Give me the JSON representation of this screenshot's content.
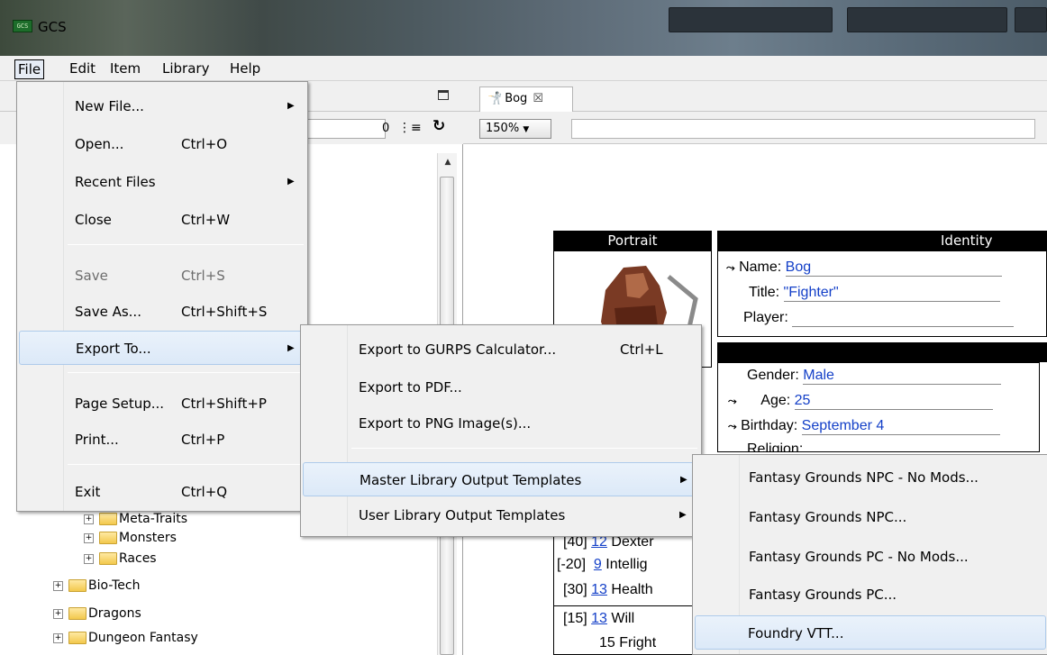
{
  "window": {
    "title": "GCS",
    "app_icon": "gcs-app-icon"
  },
  "menubar": [
    "File",
    "Edit",
    "Item",
    "Library",
    "Help"
  ],
  "library": {
    "search_count": "0",
    "tree": [
      {
        "label": "Meta-Traits"
      },
      {
        "label": "Monsters"
      },
      {
        "label": "Races"
      },
      {
        "label": "Bio-Tech"
      },
      {
        "label": "Dragons"
      },
      {
        "label": "Dungeon Fantasy"
      }
    ]
  },
  "sheet": {
    "tab_label": "Bog",
    "zoom": "150%",
    "portrait_header": "Portrait",
    "identity_header": "Identity",
    "identity": {
      "name_label": "Name:",
      "name": "Bog",
      "title_label": "Title:",
      "title": "\"Fighter\"",
      "player_label": "Player:"
    },
    "description": {
      "gender_label": "Gender:",
      "gender": "Male",
      "age_label": "Age:",
      "age": "25",
      "birthday_label": "Birthday:",
      "birthday": "September 4",
      "religion_label": "Religion:"
    },
    "attributes": [
      {
        "cost": "[40]",
        "value": "12",
        "name": "Dexter"
      },
      {
        "cost": "[-20]",
        "value": "9",
        "name": "Intellig"
      },
      {
        "cost": "[30]",
        "value": "13",
        "name": "Health"
      },
      {
        "cost": "[15]",
        "value": "13",
        "name": "Will"
      },
      {
        "cost": "",
        "value": "15",
        "name": "Fright"
      }
    ]
  },
  "file_menu": [
    {
      "label": "New File...",
      "accel": "",
      "submenu": true
    },
    {
      "label": "Open...",
      "accel": "Ctrl+O"
    },
    {
      "label": "Recent Files",
      "accel": "",
      "submenu": true
    },
    {
      "label": "Close",
      "accel": "Ctrl+W"
    },
    {
      "label": "Save",
      "accel": "Ctrl+S",
      "disabled": true
    },
    {
      "label": "Save As...",
      "accel": "Ctrl+Shift+S"
    },
    {
      "label": "Export To...",
      "accel": "",
      "submenu": true,
      "highlighted": true
    },
    {
      "label": "Page Setup...",
      "accel": "Ctrl+Shift+P"
    },
    {
      "label": "Print...",
      "accel": "Ctrl+P"
    },
    {
      "label": "Exit",
      "accel": "Ctrl+Q"
    }
  ],
  "export_menu": [
    {
      "label": "Export to GURPS Calculator...",
      "accel": "Ctrl+L"
    },
    {
      "label": "Export to PDF...",
      "accel": ""
    },
    {
      "label": "Export to PNG Image(s)...",
      "accel": ""
    },
    {
      "label": "Master Library Output Templates",
      "accel": "",
      "submenu": true,
      "highlighted": true
    },
    {
      "label": "User Library Output Templates",
      "accel": "",
      "submenu": true
    }
  ],
  "templates_menu": [
    {
      "label": "Fantasy Grounds NPC - No Mods..."
    },
    {
      "label": "Fantasy Grounds NPC..."
    },
    {
      "label": "Fantasy Grounds PC - No Mods..."
    },
    {
      "label": "Fantasy Grounds PC..."
    },
    {
      "label": "Foundry VTT...",
      "highlighted": true
    }
  ],
  "colors": {
    "menu_highlight": "#dce9f8",
    "link_blue": "#1440c8",
    "sheet_header": "#000000"
  }
}
